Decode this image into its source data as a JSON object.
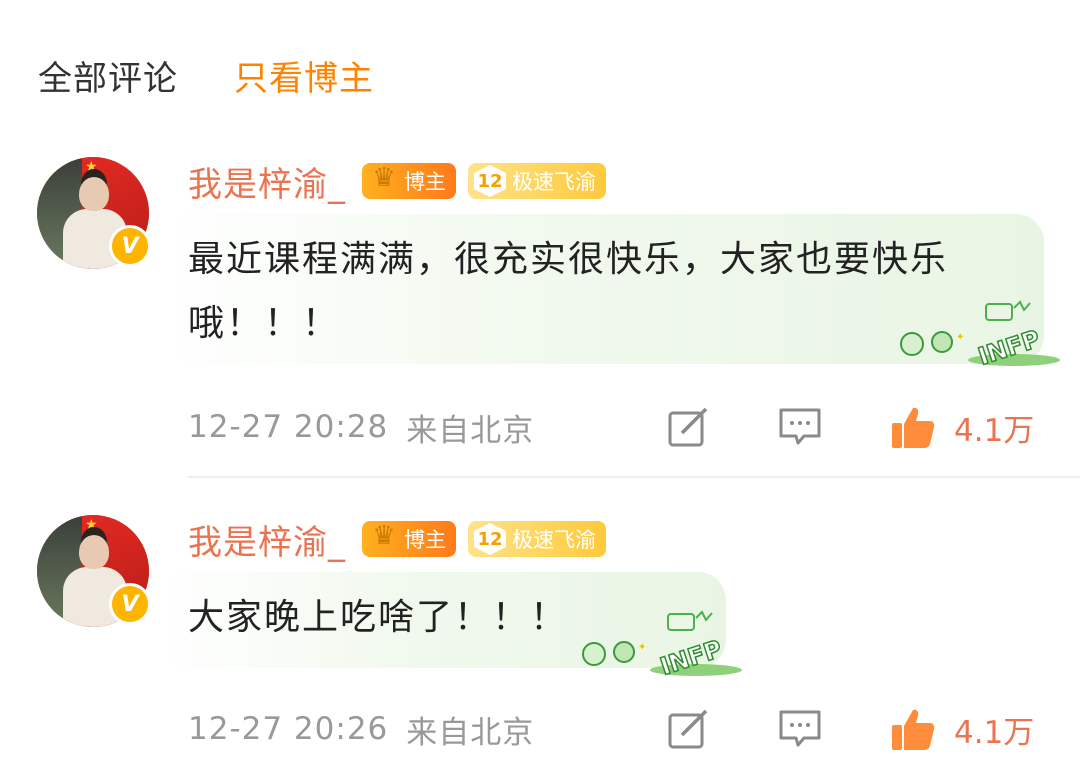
{
  "tabs": {
    "all": "全部评论",
    "host_only": "只看博主"
  },
  "colors": {
    "accent": "#ff8200",
    "username": "#eb7350",
    "meta": "#999999",
    "bubble": "#e9f5e4"
  },
  "comments": [
    {
      "username": "我是梓渝_",
      "host_badge": "博主",
      "level_badge": {
        "level": "12",
        "label": "极速飞渝"
      },
      "text": "最近课程满满，很充实很快乐，大家也要快乐哦！！！",
      "time": "12-27 20:28",
      "location": "来自北京",
      "likes": "4.1万",
      "sticker_text": "INFP"
    },
    {
      "username": "我是梓渝_",
      "host_badge": "博主",
      "level_badge": {
        "level": "12",
        "label": "极速飞渝"
      },
      "text": "大家晚上吃啥了！！！",
      "time": "12-27 20:26",
      "location": "来自北京",
      "likes": "4.1万",
      "sticker_text": "INFP"
    }
  ],
  "icons": {
    "verified": "verified-v-icon",
    "crown": "crown-icon",
    "share": "share-icon",
    "reply": "comment-icon",
    "like": "thumbs-up-icon"
  }
}
